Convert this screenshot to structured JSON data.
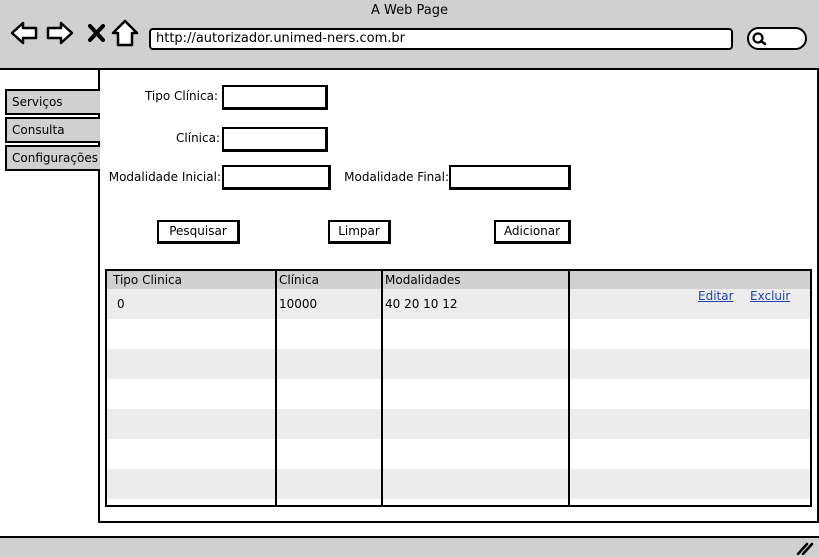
{
  "window": {
    "title": "A Web Page"
  },
  "browser": {
    "url": "http://autorizador.unimed-ners.com.br",
    "icons": [
      "back-arrow-icon",
      "forward-arrow-icon",
      "close-icon",
      "home-icon",
      "search-icon"
    ]
  },
  "sidebar": {
    "items": [
      {
        "label": "Serviços"
      },
      {
        "label": "Consulta"
      },
      {
        "label": "Configurações"
      }
    ]
  },
  "form": {
    "tipo_clinica_label": "Tipo Clínica:",
    "tipo_clinica_value": "",
    "clinica_label": "Clínica:",
    "clinica_value": "",
    "modalidade_inicial_label": "Modalidade Inicial:",
    "modalidade_inicial_value": "",
    "modalidade_final_label": "Modalidade Final:",
    "modalidade_final_value": ""
  },
  "buttons": {
    "pesquisar": "Pesquisar",
    "limpar": "Limpar",
    "adicionar": "Adicionar"
  },
  "table": {
    "columns": [
      "Tipo Clinica",
      "Clínica",
      "Modalidades",
      ""
    ],
    "rows": [
      {
        "tipo_clinica": "0",
        "clinica": "10000",
        "modalidades": "40 20 10 12",
        "edit": "Editar",
        "delete": "Excluir"
      }
    ]
  },
  "colors": {
    "chrome": "#d0d0d0",
    "link": "#2244aa",
    "row_alt": "#ececec"
  }
}
